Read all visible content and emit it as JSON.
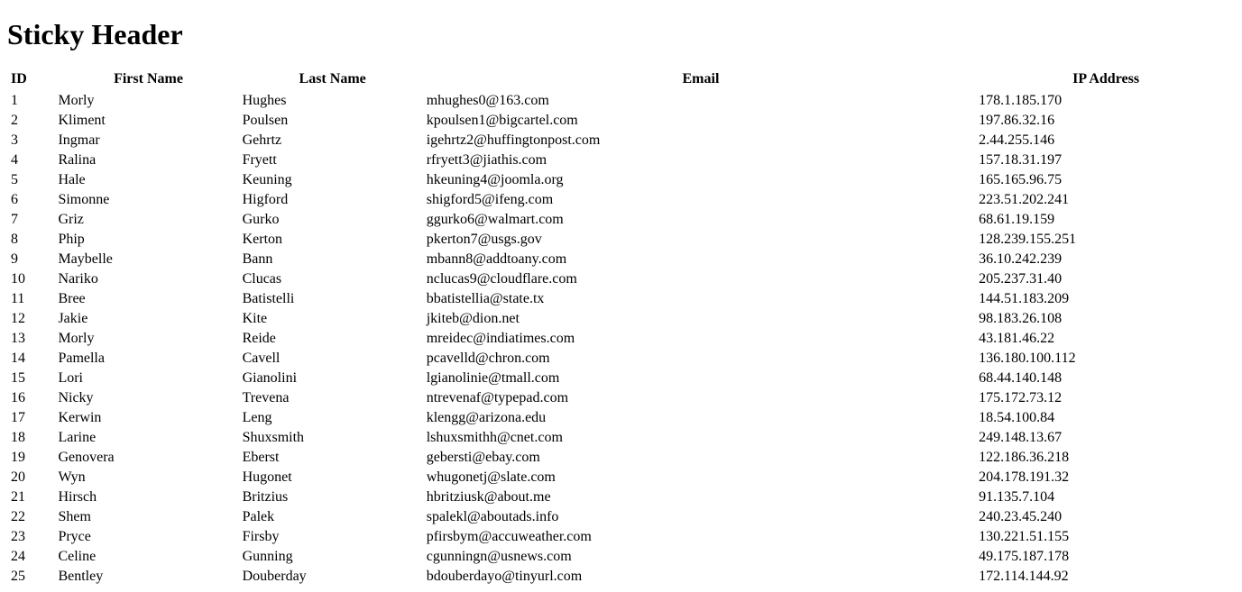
{
  "title": "Sticky Header",
  "columns": [
    "ID",
    "First Name",
    "Last Name",
    "Email",
    "IP Address"
  ],
  "rows": [
    {
      "id": "1",
      "first": "Morly",
      "last": "Hughes",
      "email": "mhughes0@163.com",
      "ip": "178.1.185.170"
    },
    {
      "id": "2",
      "first": "Kliment",
      "last": "Poulsen",
      "email": "kpoulsen1@bigcartel.com",
      "ip": "197.86.32.16"
    },
    {
      "id": "3",
      "first": "Ingmar",
      "last": "Gehrtz",
      "email": "igehrtz2@huffingtonpost.com",
      "ip": "2.44.255.146"
    },
    {
      "id": "4",
      "first": "Ralina",
      "last": "Fryett",
      "email": "rfryett3@jiathis.com",
      "ip": "157.18.31.197"
    },
    {
      "id": "5",
      "first": "Hale",
      "last": "Keuning",
      "email": "hkeuning4@joomla.org",
      "ip": "165.165.96.75"
    },
    {
      "id": "6",
      "first": "Simonne",
      "last": "Higford",
      "email": "shigford5@ifeng.com",
      "ip": "223.51.202.241"
    },
    {
      "id": "7",
      "first": "Griz",
      "last": "Gurko",
      "email": "ggurko6@walmart.com",
      "ip": "68.61.19.159"
    },
    {
      "id": "8",
      "first": "Phip",
      "last": "Kerton",
      "email": "pkerton7@usgs.gov",
      "ip": "128.239.155.251"
    },
    {
      "id": "9",
      "first": "Maybelle",
      "last": "Bann",
      "email": "mbann8@addtoany.com",
      "ip": "36.10.242.239"
    },
    {
      "id": "10",
      "first": "Nariko",
      "last": "Clucas",
      "email": "nclucas9@cloudflare.com",
      "ip": "205.237.31.40"
    },
    {
      "id": "11",
      "first": "Bree",
      "last": "Batistelli",
      "email": "bbatistellia@state.tx",
      "ip": "144.51.183.209"
    },
    {
      "id": "12",
      "first": "Jakie",
      "last": "Kite",
      "email": "jkiteb@dion.net",
      "ip": "98.183.26.108"
    },
    {
      "id": "13",
      "first": "Morly",
      "last": "Reide",
      "email": "mreidec@indiatimes.com",
      "ip": "43.181.46.22"
    },
    {
      "id": "14",
      "first": "Pamella",
      "last": "Cavell",
      "email": "pcavelld@chron.com",
      "ip": "136.180.100.112"
    },
    {
      "id": "15",
      "first": "Lori",
      "last": "Gianolini",
      "email": "lgianolinie@tmall.com",
      "ip": "68.44.140.148"
    },
    {
      "id": "16",
      "first": "Nicky",
      "last": "Trevena",
      "email": "ntrevenaf@typepad.com",
      "ip": "175.172.73.12"
    },
    {
      "id": "17",
      "first": "Kerwin",
      "last": "Leng",
      "email": "klengg@arizona.edu",
      "ip": "18.54.100.84"
    },
    {
      "id": "18",
      "first": "Larine",
      "last": "Shuxsmith",
      "email": "lshuxsmithh@cnet.com",
      "ip": "249.148.13.67"
    },
    {
      "id": "19",
      "first": "Genovera",
      "last": "Eberst",
      "email": "gebersti@ebay.com",
      "ip": "122.186.36.218"
    },
    {
      "id": "20",
      "first": "Wyn",
      "last": "Hugonet",
      "email": "whugonetj@slate.com",
      "ip": "204.178.191.32"
    },
    {
      "id": "21",
      "first": "Hirsch",
      "last": "Britzius",
      "email": "hbritziusk@about.me",
      "ip": "91.135.7.104"
    },
    {
      "id": "22",
      "first": "Shem",
      "last": "Palek",
      "email": "spalekl@aboutads.info",
      "ip": "240.23.45.240"
    },
    {
      "id": "23",
      "first": "Pryce",
      "last": "Firsby",
      "email": "pfirsbym@accuweather.com",
      "ip": "130.221.51.155"
    },
    {
      "id": "24",
      "first": "Celine",
      "last": "Gunning",
      "email": "cgunningn@usnews.com",
      "ip": "49.175.187.178"
    },
    {
      "id": "25",
      "first": "Bentley",
      "last": "Douberday",
      "email": "bdouberdayo@tinyurl.com",
      "ip": "172.114.144.92"
    }
  ]
}
